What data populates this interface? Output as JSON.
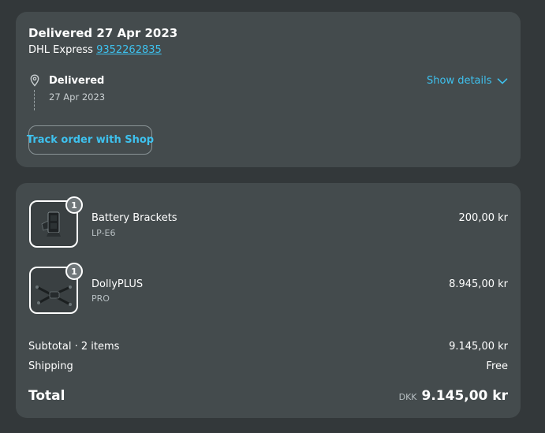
{
  "delivery": {
    "title": "Delivered 27 Apr 2023",
    "carrier": "DHL Express",
    "tracking_number": "9352262835",
    "status_label": "Delivered",
    "status_date": "27 Apr 2023",
    "show_details": "Show details",
    "track_button": "Track order with Shop"
  },
  "items": [
    {
      "name": "Battery Brackets",
      "variant": "LP-E6",
      "price": "200,00 kr",
      "quantity": "1",
      "image": "battery-brackets-image"
    },
    {
      "name": "DollyPLUS",
      "variant": "PRO",
      "price": "8.945,00 kr",
      "quantity": "1",
      "image": "dolly-image"
    }
  ],
  "summary": {
    "subtotal_label": "Subtotal · 2 items",
    "subtotal_value": "9.145,00 kr",
    "shipping_label": "Shipping",
    "shipping_value": "Free",
    "total_label": "Total",
    "total_currency": "DKK",
    "total_value": "9.145,00 kr"
  },
  "colors": {
    "background": "#33383a",
    "card": "#444b4d",
    "accent": "#3ec1ee",
    "text": "#ffffff"
  }
}
